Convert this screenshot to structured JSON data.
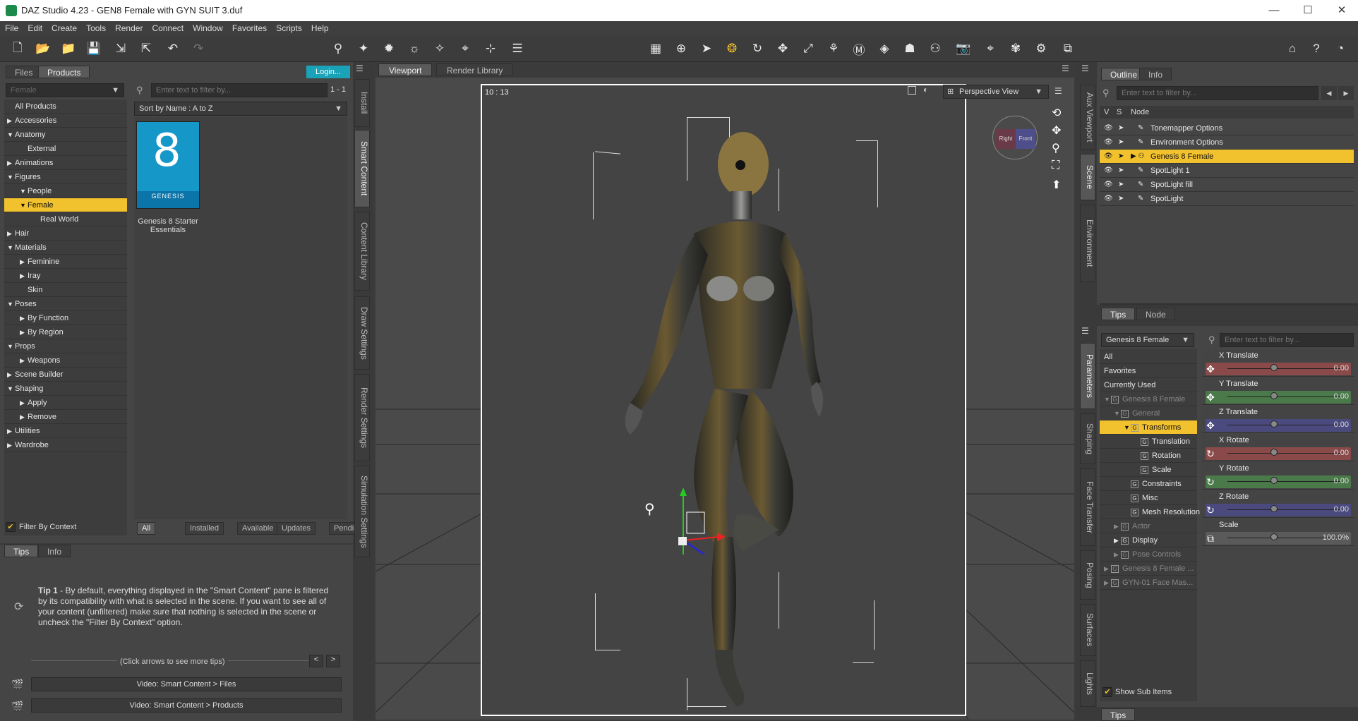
{
  "window": {
    "title": "DAZ Studio 4.23 - GEN8 Female with GYN SUIT 3.duf",
    "minimize": "—",
    "maximize": "☐",
    "close": "✕"
  },
  "menu": [
    "File",
    "Edit",
    "Create",
    "Tools",
    "Render",
    "Connect",
    "Window",
    "Favorites",
    "Scripts",
    "Help"
  ],
  "left": {
    "tabs": [
      "Files",
      "Products"
    ],
    "login": "Login...",
    "category_select": "Female",
    "filter_placeholder": "Enter text to filter by...",
    "count": "1 - 1",
    "sort": "Sort by Name : A to Z",
    "tree": [
      {
        "label": "All Products",
        "level": 0,
        "arrow": ""
      },
      {
        "label": "Accessories",
        "level": 0,
        "arrow": "▶"
      },
      {
        "label": "Anatomy",
        "level": 0,
        "arrow": "▼"
      },
      {
        "label": "External",
        "level": 1,
        "arrow": ""
      },
      {
        "label": "Animations",
        "level": 0,
        "arrow": "▶"
      },
      {
        "label": "Figures",
        "level": 0,
        "arrow": "▼"
      },
      {
        "label": "People",
        "level": 1,
        "arrow": "▼"
      },
      {
        "label": "Female",
        "level": 1,
        "arrow": "▼",
        "selected": true
      },
      {
        "label": "Real World",
        "level": 2,
        "arrow": ""
      },
      {
        "label": "Hair",
        "level": 0,
        "arrow": "▶"
      },
      {
        "label": "Materials",
        "level": 0,
        "arrow": "▼"
      },
      {
        "label": "Feminine",
        "level": 1,
        "arrow": "▶"
      },
      {
        "label": "Iray",
        "level": 1,
        "arrow": "▶"
      },
      {
        "label": "Skin",
        "level": 1,
        "arrow": ""
      },
      {
        "label": "Poses",
        "level": 0,
        "arrow": "▼"
      },
      {
        "label": "By Function",
        "level": 1,
        "arrow": "▶"
      },
      {
        "label": "By Region",
        "level": 1,
        "arrow": "▶"
      },
      {
        "label": "Props",
        "level": 0,
        "arrow": "▼"
      },
      {
        "label": "Weapons",
        "level": 1,
        "arrow": "▶"
      },
      {
        "label": "Scene Builder",
        "level": 0,
        "arrow": "▶"
      },
      {
        "label": "Shaping",
        "level": 0,
        "arrow": "▼"
      },
      {
        "label": "Apply",
        "level": 1,
        "arrow": "▶"
      },
      {
        "label": "Remove",
        "level": 1,
        "arrow": "▶"
      },
      {
        "label": "Utilities",
        "level": 0,
        "arrow": "▶"
      },
      {
        "label": "Wardrobe",
        "level": 0,
        "arrow": "▶"
      }
    ],
    "product": {
      "name": "Genesis 8 Starter Essentials",
      "cover_number": "8",
      "cover_text": "GENESIS"
    },
    "filter_by_context": "Filter By Context",
    "bottom_tabs": [
      "All",
      "Installed",
      "Available",
      "Updates",
      "Pending"
    ],
    "vtabs": [
      "Install",
      "Smart Content",
      "Content Library",
      "Draw Settings",
      "Render Settings",
      "Simulation Settings"
    ]
  },
  "tips": {
    "tabs": [
      "Tips",
      "Info"
    ],
    "text_bold": "Tip 1",
    "text": " - By default, everything displayed in the \"Smart Content\" pane is filtered by its compatibility with what is selected in the scene. If you want to see all of your content (unfiltered) make sure that nothing is selected in the scene or uncheck the \"Filter By Context\" option.",
    "hint": "(Click arrows to see more tips)",
    "prev": "<",
    "next": ">",
    "videos": [
      "Video: Smart Content > Files",
      "Video: Smart Content > Products"
    ]
  },
  "viewport": {
    "tabs": [
      "Viewport",
      "Render Library"
    ],
    "frame_time": "10 : 13",
    "view": "Perspective View",
    "cube_left": "Right",
    "cube_right": "Front"
  },
  "scene": {
    "tabs": [
      "Outline",
      "Info"
    ],
    "filter_placeholder": "Enter text to filter by...",
    "cols": [
      "V",
      "S",
      "Node"
    ],
    "nodes": [
      {
        "label": "Tonemapper Options",
        "selected": false
      },
      {
        "label": "Environment Options",
        "selected": false
      },
      {
        "label": "Genesis 8 Female",
        "selected": true
      },
      {
        "label": "SpotLight 1",
        "selected": false
      },
      {
        "label": "SpotLight fill",
        "selected": false
      },
      {
        "label": "SpotLight",
        "selected": false
      }
    ],
    "vtabs": [
      "Aux Viewport",
      "Scene",
      "Environment"
    ],
    "lower_tabs": [
      "Tips",
      "Node"
    ]
  },
  "params": {
    "node_select": "Genesis 8 Female",
    "filter_placeholder": "Enter text to filter by...",
    "tree": [
      {
        "label": "All",
        "indent": 0,
        "arrow": "",
        "dim": false
      },
      {
        "label": "Favorites",
        "indent": 0,
        "arrow": "",
        "dim": false
      },
      {
        "label": "Currently Used",
        "indent": 0,
        "arrow": "",
        "dim": false
      },
      {
        "label": "Genesis 8 Female",
        "indent": 0,
        "arrow": "▼",
        "dim": true
      },
      {
        "label": "General",
        "indent": 1,
        "arrow": "▼",
        "dim": true
      },
      {
        "label": "Transforms",
        "indent": 2,
        "arrow": "▼",
        "dim": false,
        "selected": true
      },
      {
        "label": "Translation",
        "indent": 3,
        "arrow": "",
        "dim": false
      },
      {
        "label": "Rotation",
        "indent": 3,
        "arrow": "",
        "dim": false
      },
      {
        "label": "Scale",
        "indent": 3,
        "arrow": "",
        "dim": false
      },
      {
        "label": "Constraints",
        "indent": 2,
        "arrow": "",
        "dim": false
      },
      {
        "label": "Misc",
        "indent": 2,
        "arrow": "",
        "dim": false
      },
      {
        "label": "Mesh Resolution",
        "indent": 2,
        "arrow": "",
        "dim": false
      },
      {
        "label": "Actor",
        "indent": 1,
        "arrow": "▶",
        "dim": true
      },
      {
        "label": "Display",
        "indent": 1,
        "arrow": "▶",
        "dim": false
      },
      {
        "label": "Pose Controls",
        "indent": 1,
        "arrow": "▶",
        "dim": true
      },
      {
        "label": "Genesis 8 Female ...",
        "indent": 0,
        "arrow": "▶",
        "dim": true
      },
      {
        "label": "GYN-01 Face Mas...",
        "indent": 0,
        "arrow": "▶",
        "dim": true
      }
    ],
    "sliders": [
      {
        "label": "X Translate",
        "value": "0.00",
        "color": "#8a4a4a",
        "icon": "✥"
      },
      {
        "label": "Y Translate",
        "value": "0.00",
        "color": "#4a7a4a",
        "icon": "✥"
      },
      {
        "label": "Z Translate",
        "value": "0.00",
        "color": "#4a4a7e",
        "icon": "✥"
      },
      {
        "label": "X Rotate",
        "value": "0.00",
        "color": "#8a4a4a",
        "icon": "↻"
      },
      {
        "label": "Y Rotate",
        "value": "0.00",
        "color": "#4a7a4a",
        "icon": "↻"
      },
      {
        "label": "Z Rotate",
        "value": "0.00",
        "color": "#4a4a7e",
        "icon": "↻"
      },
      {
        "label": "Scale",
        "value": "100.0%",
        "color": "#5a5a5a",
        "icon": "⧉"
      }
    ],
    "show_sub_items": "Show Sub Items",
    "vtabs": [
      "Parameters",
      "Shaping",
      "Face Transfer",
      "Posing",
      "Surfaces",
      "Lights"
    ],
    "bottom_tab": "Tips"
  },
  "colors": {
    "selection": "#f2c12e",
    "login": "#1aa3b8",
    "panel": "#454545"
  }
}
